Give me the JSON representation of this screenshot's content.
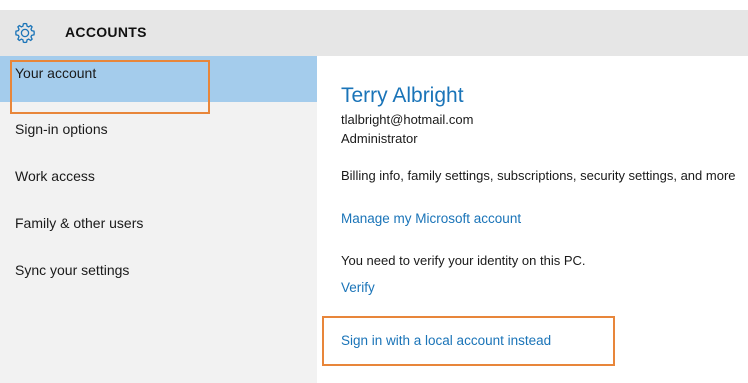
{
  "header": {
    "title": "ACCOUNTS",
    "icon": "gear-icon",
    "accent_color": "#1a74b8"
  },
  "sidebar": {
    "items": [
      {
        "label": "Your account",
        "selected": true
      },
      {
        "label": "Sign-in options"
      },
      {
        "label": "Work access"
      },
      {
        "label": "Family & other users"
      },
      {
        "label": "Sync your settings"
      }
    ]
  },
  "account": {
    "name": "Terry Albright",
    "email": "tlalbright@hotmail.com",
    "role": "Administrator",
    "billing_text": "Billing info, family settings, subscriptions, security settings, and more",
    "manage_link": "Manage my Microsoft account",
    "verify_text": "You need to verify your identity on this PC.",
    "verify_link": "Verify",
    "local_account_link": "Sign in with a local account instead"
  }
}
